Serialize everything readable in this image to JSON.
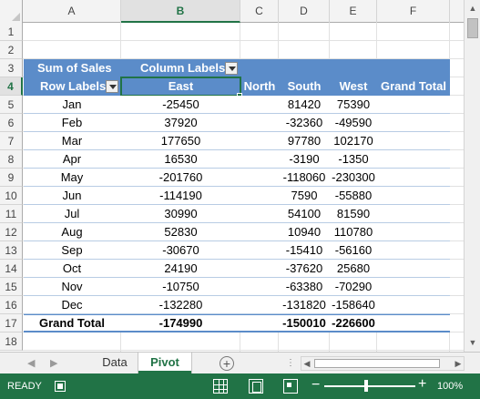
{
  "columns": [
    "A",
    "B",
    "C",
    "D",
    "E",
    "F"
  ],
  "selected_column": "B",
  "rows": [
    "1",
    "2",
    "3",
    "4",
    "5",
    "6",
    "7",
    "8",
    "9",
    "10",
    "11",
    "12",
    "13",
    "14",
    "15",
    "16",
    "17",
    "18"
  ],
  "selected_row": "4",
  "pivot": {
    "value_label": "Sum of Sales",
    "column_labels": "Column Labels",
    "row_labels": "Row Labels",
    "headers": [
      "East",
      "North",
      "South",
      "West",
      "Grand Total"
    ],
    "data_rows": [
      {
        "label": "Jan",
        "east": "-25450",
        "north": "",
        "south": "81420",
        "west": "75390",
        "total": ""
      },
      {
        "label": "Feb",
        "east": "37920",
        "north": "",
        "south": "-32360",
        "west": "-49590",
        "total": ""
      },
      {
        "label": "Mar",
        "east": "177650",
        "north": "",
        "south": "97780",
        "west": "102170",
        "total": ""
      },
      {
        "label": "Apr",
        "east": "16530",
        "north": "",
        "south": "-3190",
        "west": "-1350",
        "total": ""
      },
      {
        "label": "May",
        "east": "-201760",
        "north": "",
        "south": "-118060",
        "west": "-230300",
        "total": ""
      },
      {
        "label": "Jun",
        "east": "-114190",
        "north": "",
        "south": "7590",
        "west": "-55880",
        "total": ""
      },
      {
        "label": "Jul",
        "east": "30990",
        "north": "",
        "south": "54100",
        "west": "81590",
        "total": ""
      },
      {
        "label": "Aug",
        "east": "52830",
        "north": "",
        "south": "10940",
        "west": "110780",
        "total": ""
      },
      {
        "label": "Sep",
        "east": "-30670",
        "north": "",
        "south": "-15410",
        "west": "-56160",
        "total": ""
      },
      {
        "label": "Oct",
        "east": "24190",
        "north": "",
        "south": "-37620",
        "west": "25680",
        "total": ""
      },
      {
        "label": "Nov",
        "east": "-10750",
        "north": "",
        "south": "-63380",
        "west": "-70290",
        "total": ""
      },
      {
        "label": "Dec",
        "east": "-132280",
        "north": "",
        "south": "-131820",
        "west": "-158640",
        "total": ""
      }
    ],
    "grand_total": {
      "label": "Grand Total",
      "east": "-174990",
      "north": "",
      "south": "-150010",
      "west": "-226600",
      "total": ""
    }
  },
  "sheets": [
    {
      "name": "Data",
      "active": false
    },
    {
      "name": "Pivot",
      "active": true
    }
  ],
  "status": {
    "ready": "READY",
    "zoom": "100%",
    "zoom_minus": "−",
    "zoom_plus": "+"
  },
  "colors": {
    "pivot_header": "#5b8cc9",
    "status_bar": "#217346"
  }
}
